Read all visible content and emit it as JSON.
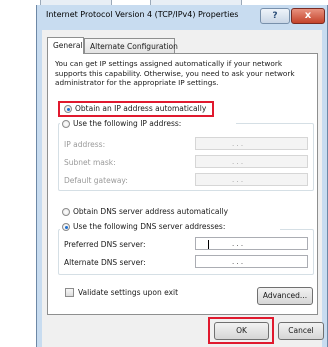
{
  "dialog": {
    "title": "Internet Protocol Version 4 (TCP/IPv4) Properties",
    "help_glyph": "?",
    "close_glyph": "x"
  },
  "tabs": [
    {
      "label": "General",
      "selected": true
    },
    {
      "label": "Alternate Configuration",
      "selected": false
    }
  ],
  "intro_text": "You can get IP settings assigned automatically if your network supports this capability. Otherwise, you need to ask your network administrator for the appropriate IP settings.",
  "ip_section": {
    "auto_label": "Obtain an IP address automatically",
    "auto_selected": true,
    "manual_label": "Use the following IP address:",
    "fields": [
      {
        "label": "IP address:",
        "value": ". . ."
      },
      {
        "label": "Subnet mask:",
        "value": ". . ."
      },
      {
        "label": "Default gateway:",
        "value": ". . ."
      }
    ]
  },
  "dns_section": {
    "auto_label": "Obtain DNS server address automatically",
    "manual_label": "Use the following DNS server addresses:",
    "manual_selected": true,
    "fields": [
      {
        "label": "Preferred DNS server:",
        "value": ". . ."
      },
      {
        "label": "Alternate DNS server:",
        "value": ". . ."
      }
    ]
  },
  "validate_label": "Validate settings upon exit",
  "validate_checked": false,
  "buttons": {
    "advanced": "Advanced...",
    "ok": "OK",
    "cancel": "Cancel"
  },
  "colors": {
    "highlight": "#e0192e",
    "window_frame": "#c8dcf0"
  }
}
